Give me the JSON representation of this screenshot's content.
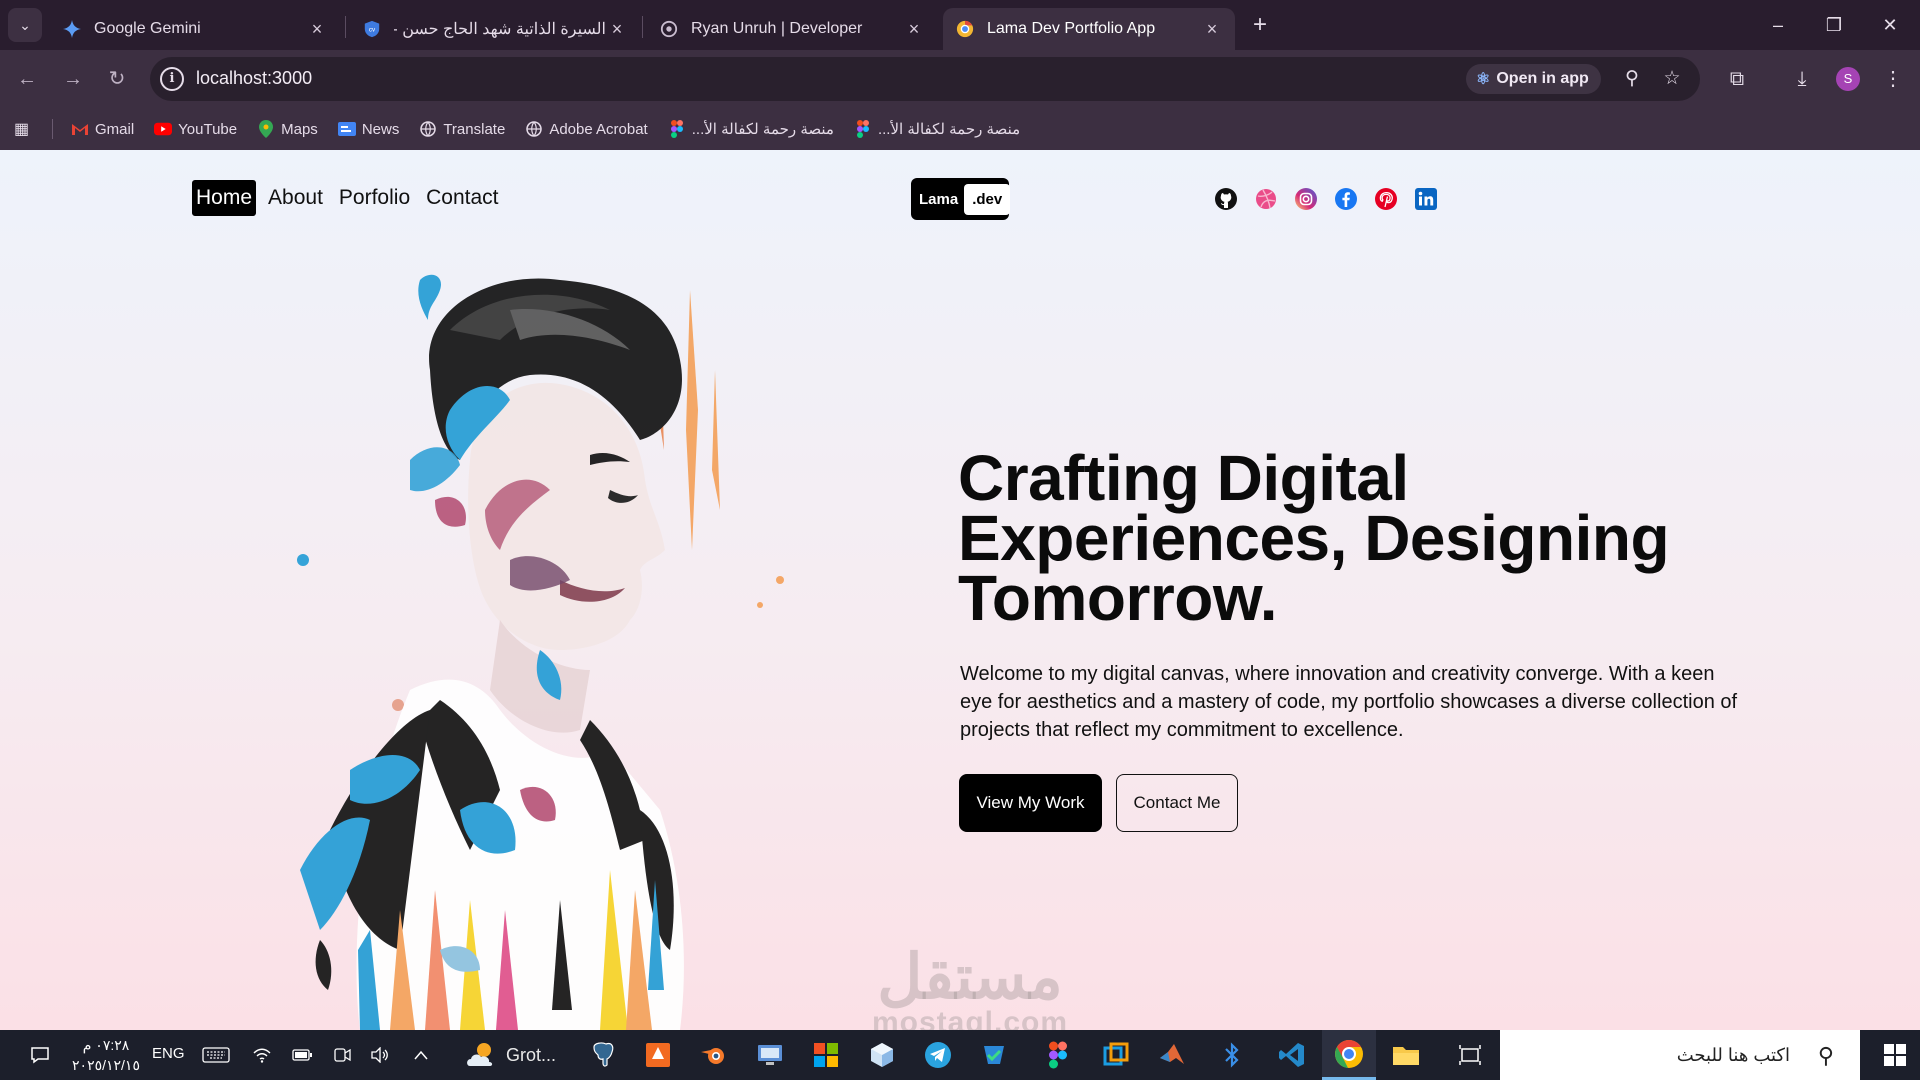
{
  "browser": {
    "tabs": [
      {
        "title": "Google Gemini",
        "favicon": "gemini-icon",
        "active": false
      },
      {
        "title": "السيرة الذاتية شهد الحاج حسن - d",
        "favicon": "cv-icon",
        "active": false
      },
      {
        "title": "Ryan Unruh | Developer",
        "favicon": "ryan-icon",
        "active": false
      },
      {
        "title": "Lama Dev Portfolio App",
        "favicon": "chrome-icon",
        "active": true
      }
    ],
    "new_tab": "+",
    "close_glyph": "×",
    "address": "localhost:3000",
    "open_in_app": "Open in app",
    "profile_initial": "S",
    "bookmarks": [
      {
        "label": "Gmail",
        "icon": "gmail-icon"
      },
      {
        "label": "YouTube",
        "icon": "youtube-icon"
      },
      {
        "label": "Maps",
        "icon": "maps-icon"
      },
      {
        "label": "News",
        "icon": "news-icon"
      },
      {
        "label": "Translate",
        "icon": "translate-icon"
      },
      {
        "label": "Adobe Acrobat",
        "icon": "acrobat-icon"
      },
      {
        "label": "منصة رحمة لكفالة الأ...",
        "icon": "figma-icon"
      },
      {
        "label": "منصة رحمة لكفالة الأ...",
        "icon": "figma-icon"
      }
    ]
  },
  "site": {
    "nav": [
      {
        "label": "Home",
        "active": true
      },
      {
        "label": "About",
        "active": false
      },
      {
        "label": "Porfolio",
        "active": false
      },
      {
        "label": "Contact",
        "active": false
      }
    ],
    "logo": {
      "left": "Lama",
      "right": ".dev"
    },
    "socials": [
      "github-icon",
      "dribbble-icon",
      "instagram-icon",
      "facebook-icon",
      "pinterest-icon",
      "linkedin-icon"
    ],
    "hero": {
      "title": "Crafting Digital Experiences, Designing Tomorrow.",
      "description": "Welcome to my digital canvas, where innovation and creativity converge. With a keen eye for aesthetics and a mastery of code, my portfolio showcases a diverse collection of projects that reflect my commitment to excellence.",
      "primary_button": "View My Work",
      "secondary_button": "Contact Me"
    },
    "watermark": {
      "arabic": "مستقل",
      "latin": "mostaql.com"
    }
  },
  "taskbar": {
    "time": "٠٧:٢٨ م",
    "date": "٢٠٢٥/١٢/١٥",
    "language": "ENG",
    "grok_label": "Grot...",
    "search_placeholder": "اكتب هنا للبحث"
  },
  "colors": {
    "tab_strip": "#291d2e",
    "toolbar": "#3c2f41",
    "page_top": "#eef3fb",
    "page_bottom": "#fbe0e6",
    "taskbar": "#1c1f2b",
    "accent": "#000000"
  }
}
